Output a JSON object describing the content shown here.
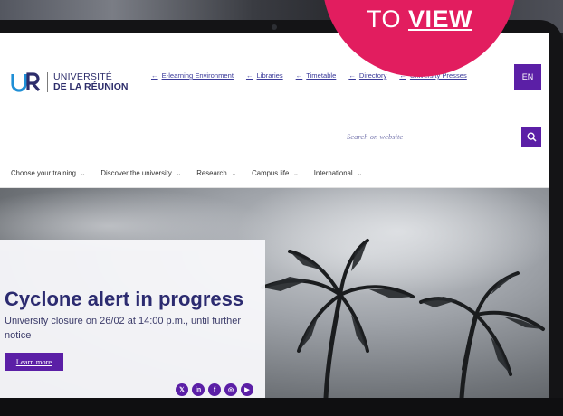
{
  "banner": {
    "prefix": "TO",
    "emphasis": "VIEW",
    "color": "#e21d5f"
  },
  "header": {
    "logo": {
      "line1": "UNIVERSITÉ",
      "line2": "DE LA RÉUNION"
    },
    "top_links": [
      {
        "arrow": "←",
        "label": "E-learning Environment"
      },
      {
        "arrow": "←",
        "label": "Libraries"
      },
      {
        "arrow": "←",
        "label": "Timetable"
      },
      {
        "arrow": "←",
        "label": "Directory"
      },
      {
        "arrow": "←",
        "label": "University Presses"
      }
    ],
    "language": "EN",
    "search": {
      "placeholder": "Search on website",
      "icon": "search-icon"
    }
  },
  "nav": {
    "items": [
      {
        "label": "Choose your training",
        "chevron": "⌄"
      },
      {
        "label": "Discover the university",
        "chevron": "⌄"
      },
      {
        "label": "Research",
        "chevron": "⌄"
      },
      {
        "label": "Campus life",
        "chevron": "⌄"
      },
      {
        "label": "International",
        "chevron": "⌄"
      }
    ]
  },
  "hero": {
    "title": "Cyclone alert in progress",
    "text": "University closure on 26/02 at 14:00 p.m., until further notice",
    "button": "Learn more",
    "socials": [
      {
        "icon": "x-icon",
        "glyph": "𝕏"
      },
      {
        "icon": "linkedin-icon",
        "glyph": "in"
      },
      {
        "icon": "facebook-icon",
        "glyph": "f"
      },
      {
        "icon": "instagram-icon",
        "glyph": "◎"
      },
      {
        "icon": "youtube-icon",
        "glyph": "▶"
      }
    ]
  },
  "colors": {
    "brand": "#5b1fa6",
    "title": "#2c2b70"
  }
}
